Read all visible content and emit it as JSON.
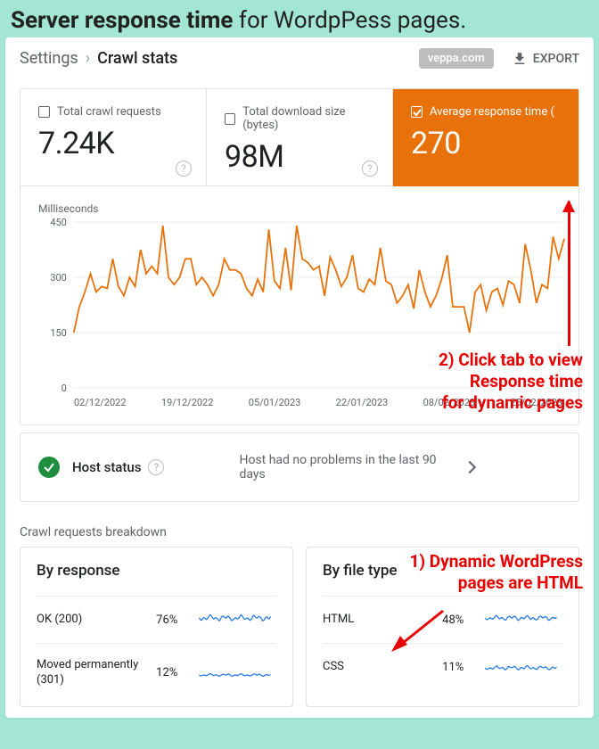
{
  "page_title_bold": "Server response time",
  "page_title_rest": " for WordpPess pages.",
  "breadcrumb": {
    "root": "Settings",
    "current": "Crawl stats"
  },
  "domain_pill": "veppa.com",
  "export_label": "EXPORT",
  "tabs": [
    {
      "label": "Total crawl requests",
      "value": "7.24K",
      "active": false
    },
    {
      "label": "Total download size (bytes)",
      "value": "98M",
      "active": false
    },
    {
      "label": "Average response time (",
      "value": "270",
      "active": true
    }
  ],
  "chart_data": {
    "type": "line",
    "title": "",
    "ylabel": "Milliseconds",
    "ylim": [
      0,
      450
    ],
    "yticks": [
      0,
      150,
      300,
      450
    ],
    "x_labels": [
      "02/12/2022",
      "19/12/2022",
      "05/01/2023",
      "22/01/2023",
      "08/02/2023",
      "25/02/2023"
    ],
    "x": [
      0,
      1,
      2,
      3,
      4,
      5,
      6,
      7,
      8,
      9,
      10,
      11,
      12,
      13,
      14,
      15,
      16,
      17,
      18,
      19,
      20,
      21,
      22,
      23,
      24,
      25,
      26,
      27,
      28,
      29,
      30,
      31,
      32,
      33,
      34,
      35,
      36,
      37,
      38,
      39,
      40,
      41,
      42,
      43,
      44,
      45,
      46,
      47,
      48,
      49,
      50,
      51,
      52,
      53,
      54,
      55,
      56,
      57,
      58,
      59,
      60,
      61,
      62,
      63,
      64,
      65,
      66,
      67,
      68,
      69,
      70,
      71,
      72,
      73,
      74,
      75,
      76,
      77,
      78,
      79,
      80,
      81,
      82,
      83,
      84,
      85,
      86,
      87,
      88
    ],
    "values": [
      150,
      220,
      260,
      310,
      260,
      275,
      270,
      350,
      275,
      250,
      300,
      275,
      375,
      310,
      330,
      310,
      440,
      300,
      280,
      300,
      350,
      350,
      280,
      300,
      280,
      250,
      280,
      350,
      320,
      320,
      310,
      270,
      250,
      295,
      260,
      430,
      290,
      270,
      380,
      265,
      440,
      350,
      340,
      320,
      330,
      250,
      355,
      320,
      275,
      300,
      360,
      270,
      260,
      295,
      280,
      380,
      290,
      280,
      230,
      250,
      280,
      215,
      320,
      260,
      220,
      250,
      295,
      360,
      220,
      220,
      220,
      150,
      260,
      280,
      210,
      260,
      270,
      225,
      290,
      280,
      230,
      390,
      320,
      230,
      280,
      270,
      410,
      350,
      405
    ],
    "color": "#e8710a"
  },
  "host": {
    "title": "Host status",
    "message": "Host had no problems in the last 90 days"
  },
  "breakdown_section": "Crawl requests breakdown",
  "by_response": {
    "title": "By response",
    "rows": [
      {
        "label": "OK (200)",
        "pct": "76%"
      },
      {
        "label": "Moved permanently (301)",
        "pct": "12%"
      }
    ]
  },
  "by_filetype": {
    "title": "By file type",
    "rows": [
      {
        "label": "HTML",
        "pct": "48%"
      },
      {
        "label": "CSS",
        "pct": "11%"
      }
    ]
  },
  "annotations": {
    "a2": "2) Click tab to view\nResponse time\nfor dynamic pages",
    "a1": "1) Dynamic WordPress\npages are HTML"
  }
}
